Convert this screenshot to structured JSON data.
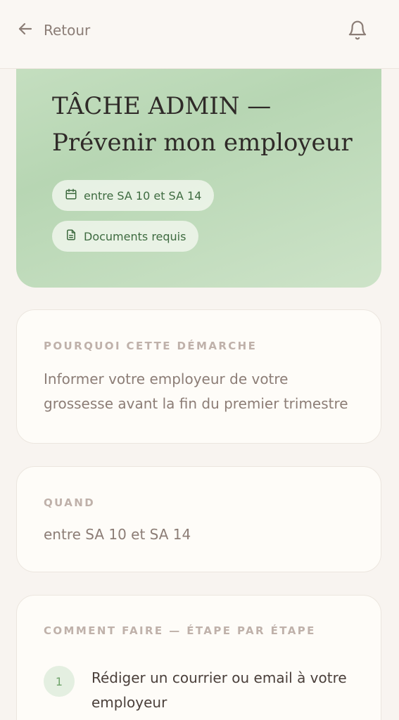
{
  "header": {
    "back_label": "Retour",
    "back_icon": "arrow-left-icon",
    "notification_icon": "bell-icon"
  },
  "hero": {
    "title_line1": "TÂCHE ADMIN —",
    "title_line2": "Prévenir mon employeur",
    "background_color": "#bfdbb9",
    "chips": [
      {
        "icon": "calendar-icon",
        "label": "entre SA 10 et SA 14"
      },
      {
        "icon": "document-icon",
        "label": "Documents requis"
      }
    ]
  },
  "why": {
    "label": "POURQUOI CETTE DÉMARCHE",
    "text": "Informer votre employeur de votre grossesse avant la fin du premier trimestre"
  },
  "when": {
    "label": "QUAND",
    "text": "entre SA 10 et SA 14"
  },
  "how": {
    "label": "COMMENT FAIRE — ÉTAPE PAR ÉTAPE",
    "steps": [
      {
        "number": "1",
        "text": "Rédiger un courrier ou email à votre employeur"
      }
    ]
  }
}
